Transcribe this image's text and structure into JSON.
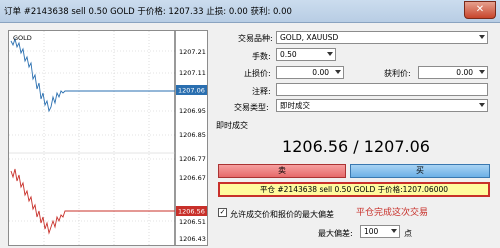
{
  "window": {
    "title": "订单 #2143638 sell 0.50 GOLD 于价格: 1207.33 止损: 0.00 获利: 0.00",
    "close_glyph": "✕"
  },
  "chart": {
    "upper_label": "GOLD",
    "upper_ticks": [
      "1207.21",
      "1207.11",
      "1207.06",
      "1206.95",
      "1206.85",
      "1206.77",
      "1206.67"
    ],
    "lower_ticks": [
      "1206.56",
      "1206.51",
      "1206.43"
    ],
    "current_price_upper": "1207.06",
    "current_price_lower": "1206.56",
    "ask_color": "#2a6fb0",
    "bid_color": "#c8302a"
  },
  "form": {
    "symbol_label": "交易品种:",
    "symbol_value": "GOLD, XAUUSD",
    "volume_label": "手数:",
    "volume_value": "0.50",
    "stop_label": "止损价:",
    "stop_value": "0.00",
    "profit_label": "获利价:",
    "profit_value": "0.00",
    "comment_label": "注释:",
    "comment_value": "",
    "type_label": "交易类型:",
    "type_value": "即时成交"
  },
  "execution": {
    "section_title": "即时成交",
    "price_display": "1206.56 / 1207.06",
    "sell_label": "卖",
    "buy_label": "买",
    "close_order_label": "平仓 #2143638 sell 0.50 GOLD 于价格:1207.06000",
    "allow_deviation_label": "允许成交价和报价的最大偏差",
    "allow_deviation_checked": true,
    "max_deviation_label": "最大偏差:",
    "max_deviation_value": "100",
    "points_label": "点",
    "annotation": "平仓完成这次交易"
  }
}
